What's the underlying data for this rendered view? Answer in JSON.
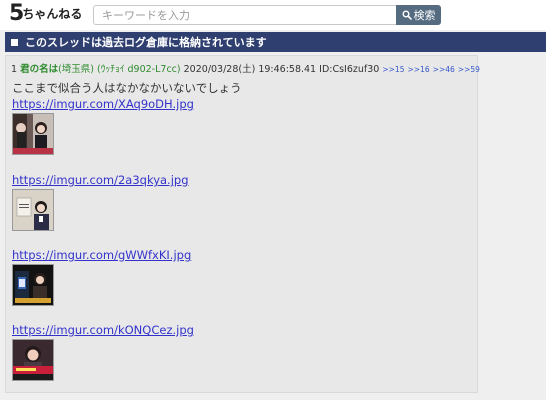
{
  "header": {
    "logo_text_main": "5",
    "logo_text_rest": "ちゃんねる",
    "search_placeholder": "キーワードを入力",
    "search_button_label": "検索"
  },
  "notice": {
    "text": "このスレッドは過去ログ倉庫に格納されています"
  },
  "post": {
    "number": "1",
    "name": "君の名は",
    "name_suffix": "(埼玉県)",
    "trip": "(ｳｯﾁｮｲ d902-L7cc)",
    "datetime": "2020/03/28(土) 19:46:58.41",
    "id": "ID:CsI6zuf30",
    "replies": [
      ">>15",
      ">>16",
      ">>46",
      ">>59"
    ],
    "message": "ここまで似合う人はなかなかいないでしょう",
    "images": [
      {
        "url": "https://imgur.com/XAq9oDH.jpg",
        "icon": "photo-thumbnail"
      },
      {
        "url": "https://imgur.com/2a3qkya.jpg",
        "icon": "photo-thumbnail"
      },
      {
        "url": "https://imgur.com/gWWfxKI.jpg",
        "icon": "photo-thumbnail"
      },
      {
        "url": "https://imgur.com/kONQCez.jpg",
        "icon": "photo-thumbnail"
      }
    ]
  },
  "colors": {
    "notice_bg": "#2f3f70",
    "search_button_bg": "#546b80",
    "name_green": "#2e8b2e",
    "link_blue": "#3333cc"
  }
}
